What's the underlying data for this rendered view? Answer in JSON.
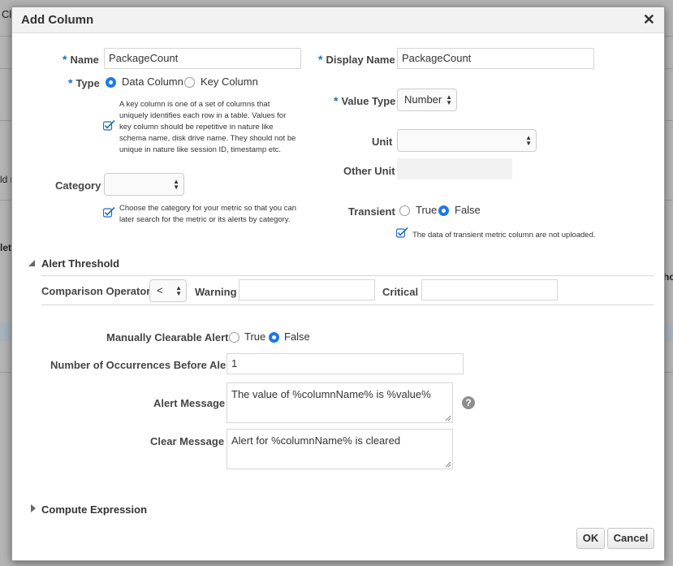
{
  "background": {
    "fragments": [
      "Cl",
      "ld n",
      "let",
      "ho"
    ]
  },
  "dialog": {
    "title": "Add Column",
    "close_glyph": "✕"
  },
  "form": {
    "name": {
      "label": "Name",
      "value": "PackageCount"
    },
    "display_name": {
      "label": "Display Name",
      "value": "PackageCount"
    },
    "type": {
      "label": "Type",
      "options": [
        "Data Column",
        "Key Column"
      ],
      "selected": "Data Column",
      "help": "A key column is one of a set of columns that uniquely identifies each row in a table. Values for key column should be repetitive in nature like schema name, disk drive name. They should not be unique in nature like session ID, timestamp etc."
    },
    "value_type": {
      "label": "Value Type",
      "selected": "Number"
    },
    "unit": {
      "label": "Unit",
      "selected": ""
    },
    "other_unit": {
      "label": "Other Unit",
      "value": ""
    },
    "category": {
      "label": "Category",
      "selected": "",
      "help": "Choose the category for your metric so that you can later search for the metric or its alerts by category."
    },
    "transient": {
      "label": "Transient",
      "options": [
        "True",
        "False"
      ],
      "selected": "False",
      "help": "The data of transient metric column are not uploaded."
    }
  },
  "alert_threshold": {
    "section_label": "Alert Threshold",
    "expanded": true,
    "comparison_operator": {
      "label": "Comparison Operator",
      "selected": "<"
    },
    "warning": {
      "label": "Warning",
      "value": ""
    },
    "critical": {
      "label": "Critical",
      "value": ""
    },
    "manually_clearable": {
      "label": "Manually Clearable Alert",
      "options": [
        "True",
        "False"
      ],
      "selected": "False"
    },
    "occurrences": {
      "label": "Number of Occurrences Before Alert",
      "value": "1"
    },
    "alert_message": {
      "label": "Alert Message",
      "value": "The value of %columnName% is %value%",
      "help_glyph": "?"
    },
    "clear_message": {
      "label": "Clear Message",
      "value": "Alert for %columnName% is cleared"
    }
  },
  "compute_expression": {
    "section_label": "Compute Expression",
    "expanded": false
  },
  "buttons": {
    "ok": "OK",
    "cancel": "Cancel"
  },
  "colors": {
    "accent": "#1c78e8",
    "required": "#1d6fb5",
    "help_check": "#1d6fb5"
  }
}
